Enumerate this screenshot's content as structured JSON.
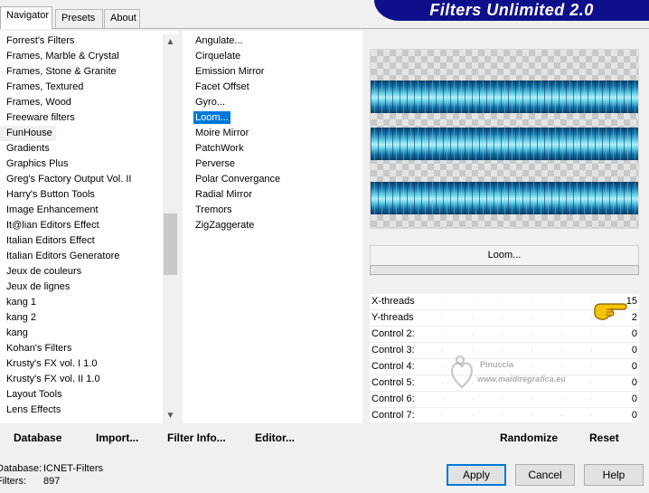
{
  "tabs": [
    {
      "label": "Navigator",
      "active": true
    },
    {
      "label": "Presets",
      "active": false
    },
    {
      "label": "About",
      "active": false
    }
  ],
  "title": "Filters Unlimited 2.0",
  "categories": {
    "items": [
      "Forrest's Filters",
      "Frames, Marble & Crystal",
      "Frames, Stone & Granite",
      "Frames, Textured",
      "Frames, Wood",
      "Freeware filters",
      "FunHouse",
      "Gradients",
      "Graphics Plus",
      "Greg's Factory Output Vol. II",
      "Harry's Button Tools",
      "Image Enhancement",
      "It@lian Editors Effect",
      "Italian Editors Effect",
      "Italian Editors Generatore",
      "Jeux de couleurs",
      "Jeux de lignes",
      "kang 1",
      "kang 2",
      "kang",
      "Kohan's Filters",
      "Krusty's FX vol. I 1.0",
      "Krusty's FX vol. II 1.0",
      "Layout Tools",
      "Lens Effects"
    ],
    "selected_index": 6
  },
  "filters": {
    "items": [
      "Angulate...",
      "Cirquelate",
      "Emission Mirror",
      "Facet Offset",
      "Gyro...",
      "Loom...",
      "Moire Mirror",
      "PatchWork",
      "Perverse",
      "Polar Convergance",
      "Radial Mirror",
      "Tremors",
      "ZigZaggerate"
    ],
    "selected_index": 5
  },
  "current_filter_label": "Loom...",
  "controls": [
    {
      "label": "X-threads",
      "value": "15"
    },
    {
      "label": "Y-threads",
      "value": "2"
    },
    {
      "label": "Control 2:",
      "value": "0"
    },
    {
      "label": "Control 3:",
      "value": "0"
    },
    {
      "label": "Control 4:",
      "value": "0"
    },
    {
      "label": "Control 5:",
      "value": "0"
    },
    {
      "label": "Control 6:",
      "value": "0"
    },
    {
      "label": "Control 7:",
      "value": "0"
    }
  ],
  "watermark": {
    "name": "Pinuccia",
    "url": "www.maidiregrafica.eu"
  },
  "actions": {
    "database": "Database",
    "import": "Import...",
    "filter_info": "Filter Info...",
    "editor": "Editor...",
    "randomize": "Randomize",
    "reset": "Reset"
  },
  "status": {
    "database_label": "Database:",
    "database_value": "ICNET-Filters",
    "filters_label": "Filters:",
    "filters_value": "897"
  },
  "dialog": {
    "apply": "Apply",
    "cancel": "Cancel",
    "help": "Help"
  },
  "colors": {
    "banner": "#0f0f8c",
    "selection": "#0078d7",
    "accent_teal": "#6dd7ec"
  }
}
